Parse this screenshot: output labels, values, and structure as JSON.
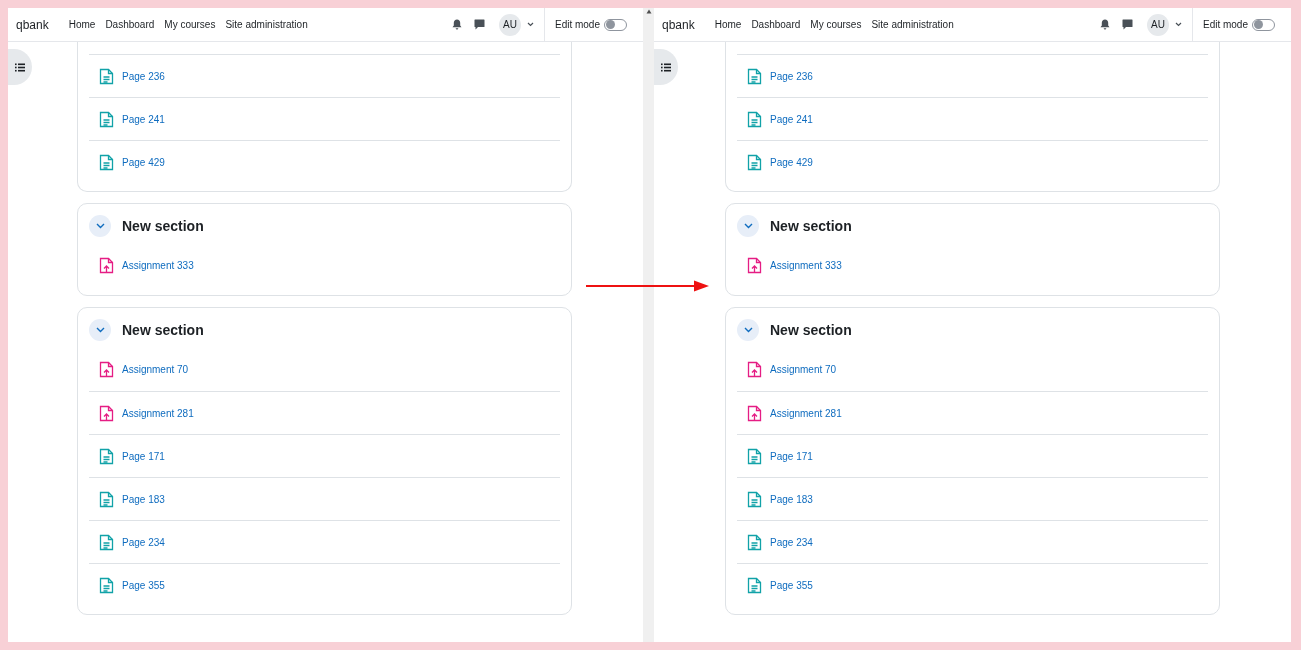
{
  "panels": [
    {
      "navbar": {
        "site_name": "qbank",
        "links": [
          "Home",
          "Dashboard",
          "My courses",
          "Site administration"
        ],
        "avatar": "AU",
        "edit_mode_label": "Edit mode",
        "edit_mode": {
          "on": false
        }
      },
      "scrollbar": true,
      "sections": [
        {
          "items": [
            {
              "kind": "page",
              "label": "Page 236"
            },
            {
              "kind": "page",
              "label": "Page 241"
            },
            {
              "kind": "page",
              "label": "Page 429"
            }
          ]
        },
        {
          "title": "New section",
          "expanded": true,
          "items": [
            {
              "kind": "assignment",
              "label": "Assignment 333"
            }
          ]
        },
        {
          "title": "New section",
          "expanded": true,
          "items": [
            {
              "kind": "assignment",
              "label": "Assignment 70"
            },
            {
              "kind": "assignment",
              "label": "Assignment 281"
            },
            {
              "kind": "page",
              "label": "Page 171"
            },
            {
              "kind": "page",
              "label": "Page 183"
            },
            {
              "kind": "page",
              "label": "Page 234"
            },
            {
              "kind": "page",
              "label": "Page 355"
            }
          ]
        }
      ]
    },
    {
      "navbar": {
        "site_name": "qbank",
        "links": [
          "Home",
          "Dashboard",
          "My courses",
          "Site administration"
        ],
        "avatar": "AU",
        "edit_mode_label": "Edit mode",
        "edit_mode": {
          "on": false
        }
      },
      "scrollbar": false,
      "sections": [
        {
          "items": [
            {
              "kind": "page",
              "label": "Page 236"
            },
            {
              "kind": "page",
              "label": "Page 241"
            },
            {
              "kind": "page",
              "label": "Page 429"
            }
          ]
        },
        {
          "title": "New section",
          "expanded": true,
          "items": [
            {
              "kind": "assignment",
              "label": "Assignment 333"
            }
          ]
        },
        {
          "title": "New section",
          "expanded": true,
          "items": [
            {
              "kind": "assignment",
              "label": "Assignment 70"
            },
            {
              "kind": "assignment",
              "label": "Assignment 281"
            },
            {
              "kind": "page",
              "label": "Page 171"
            },
            {
              "kind": "page",
              "label": "Page 183"
            },
            {
              "kind": "page",
              "label": "Page 234"
            },
            {
              "kind": "page",
              "label": "Page 355"
            }
          ]
        }
      ]
    }
  ]
}
